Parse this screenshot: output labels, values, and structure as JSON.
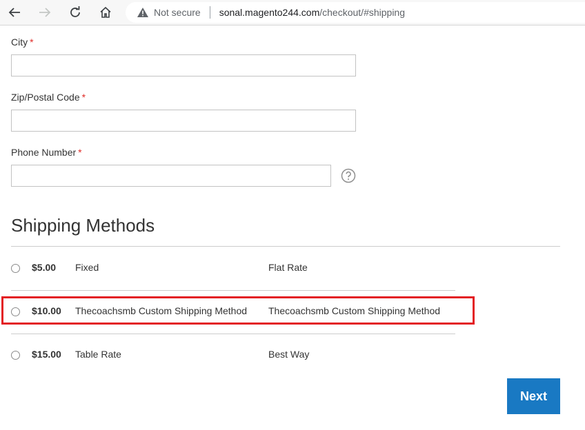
{
  "browser": {
    "not_secure": "Not secure",
    "url_host": "sonal.magento244.com",
    "url_path": "/checkout/#shipping"
  },
  "form": {
    "city_label": "City",
    "zip_label": "Zip/Postal Code",
    "phone_label": "Phone Number",
    "required_mark": "*",
    "city_value": "",
    "zip_value": "",
    "phone_value": ""
  },
  "shipping": {
    "title": "Shipping Methods",
    "methods": [
      {
        "price": "$5.00",
        "method": "Fixed",
        "carrier": "Flat Rate",
        "selected": false
      },
      {
        "price": "$10.00",
        "method": "Thecoachsmb Custom Shipping Method",
        "carrier": "Thecoachsmb Custom Shipping Method",
        "selected": false,
        "highlighted": true
      },
      {
        "price": "$15.00",
        "method": "Table Rate",
        "carrier": "Best Way",
        "selected": false
      }
    ]
  },
  "actions": {
    "next_label": "Next"
  },
  "colors": {
    "accent": "#1979c3",
    "required": "#e02b27",
    "highlight": "#e31e24"
  }
}
